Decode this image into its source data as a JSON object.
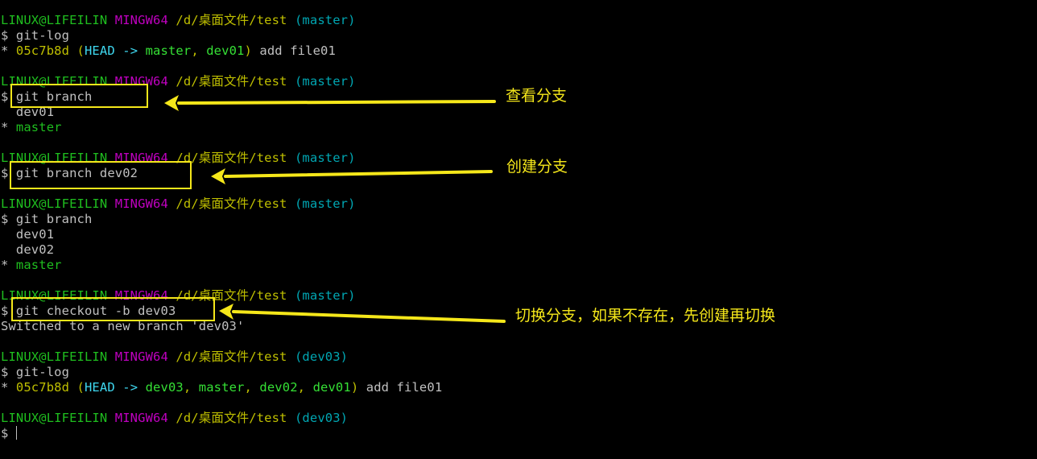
{
  "prompt": {
    "user": "LINUX@LIFEILIN",
    "system": "MINGW64",
    "path": "/d/桌面文件/test"
  },
  "blocks": [
    {
      "branch": "(master)",
      "command": "git-log",
      "output": {
        "type": "log",
        "star": "*",
        "hash": "05c7b8d",
        "open": "(",
        "head": "HEAD ->",
        "refs": [
          "master",
          "dev01"
        ],
        "close": ")",
        "message": "add file01"
      }
    },
    {
      "branch": "(master)",
      "command": "git branch",
      "output": {
        "type": "branches",
        "items": [
          {
            "name": "dev01",
            "current": false
          },
          {
            "name": "master",
            "current": true
          }
        ]
      }
    },
    {
      "branch": "(master)",
      "command": "git branch dev02"
    },
    {
      "branch": "(master)",
      "command": "git branch",
      "output": {
        "type": "branches",
        "items": [
          {
            "name": "dev01",
            "current": false
          },
          {
            "name": "dev02",
            "current": false
          },
          {
            "name": "master",
            "current": true
          }
        ]
      }
    },
    {
      "branch": "(master)",
      "command": "git checkout -b dev03",
      "output": {
        "type": "text",
        "text": "Switched to a new branch 'dev03'"
      }
    },
    {
      "branch": "(dev03)",
      "command": "git-log",
      "output": {
        "type": "log",
        "star": "*",
        "hash": "05c7b8d",
        "open": "(",
        "head": "HEAD ->",
        "refs": [
          "dev03",
          "master",
          "dev02",
          "dev01"
        ],
        "close": ")",
        "message": "add file01"
      }
    },
    {
      "branch": "(dev03)",
      "command": ""
    }
  ],
  "symbols": {
    "dollar": "$",
    "star": "*"
  },
  "annotations": [
    {
      "label": "查看分支",
      "target": "git branch"
    },
    {
      "label": "创建分支",
      "target": "git branch dev02"
    },
    {
      "label": "切换分支，如果不存在，先创建再切换",
      "target": "git checkout -b dev03"
    }
  ],
  "colors": {
    "background": "#000000",
    "user": "#1fbe1f",
    "system": "#bf00bf",
    "path": "#bfbf00",
    "branch": "#00a6b2",
    "highlight": "#f5e71a"
  }
}
